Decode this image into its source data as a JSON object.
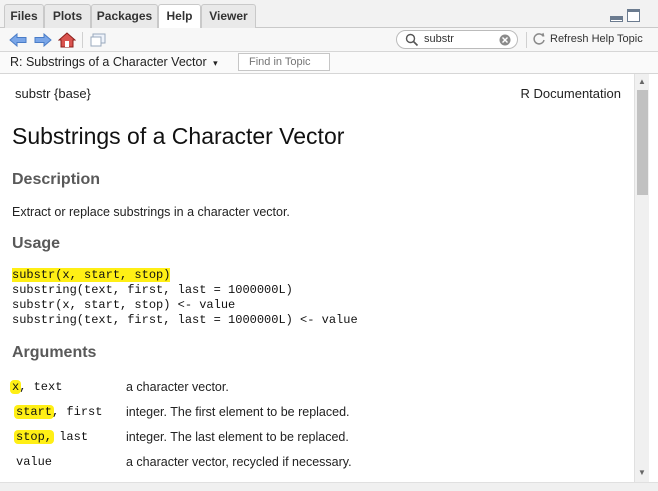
{
  "tabs": [
    {
      "label": "Files",
      "active": false
    },
    {
      "label": "Plots",
      "active": false
    },
    {
      "label": "Packages",
      "active": false
    },
    {
      "label": "Help",
      "active": true
    },
    {
      "label": "Viewer",
      "active": false
    }
  ],
  "toolbar": {
    "search_value": "substr",
    "refresh_label": "Refresh Help Topic"
  },
  "topic": {
    "title": "R: Substrings of a Character Vector",
    "find_placeholder": "Find in Topic"
  },
  "doc": {
    "package": "substr {base}",
    "rdoc": "R Documentation",
    "title": "Substrings of a Character Vector",
    "description_heading": "Description",
    "description_text": "Extract or replace substrings in a character vector.",
    "usage_heading": "Usage",
    "usage_lines": [
      "substr(x, start, stop)",
      "substring(text, first, last = 1000000L)",
      "substr(x, start, stop) <- value",
      "substring(text, first, last = 1000000L) <- value"
    ],
    "arguments_heading": "Arguments",
    "arguments": [
      {
        "name_main": "x",
        "name_rest": ", text",
        "desc": "a character vector."
      },
      {
        "name_main": "start",
        "name_rest": ", first",
        "desc": "integer. The first element to be replaced."
      },
      {
        "name_main": "stop,",
        "name_rest": " last",
        "desc": "integer. The last element to be replaced."
      },
      {
        "name_main": "",
        "name_rest": "value",
        "desc": "a character vector, recycled if necessary."
      }
    ]
  },
  "colors": {
    "highlight": "#ffef15",
    "nav_arrow": "#5b8fd8",
    "home": "#c0392b"
  }
}
